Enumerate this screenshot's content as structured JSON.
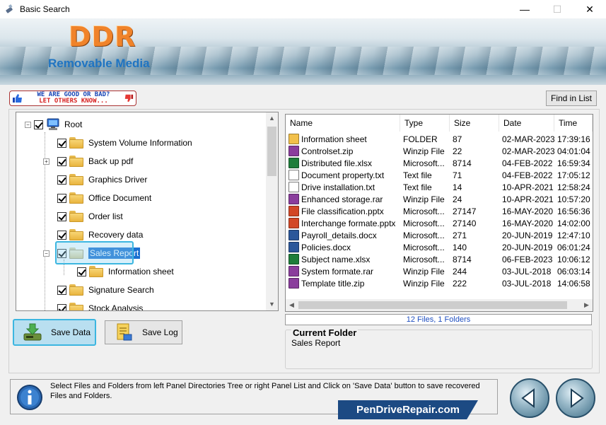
{
  "window": {
    "title": "Basic Search",
    "minimize": "—",
    "maximize": "☐",
    "close": "✕"
  },
  "banner": {
    "brand": "DDR",
    "subtitle": "Removable Media"
  },
  "rating": {
    "line1": "WE ARE GOOD OR BAD?",
    "line2": "LET OTHERS KNOW..."
  },
  "toolbar": {
    "find_label": "Find in List"
  },
  "tree": {
    "root": "Root",
    "items": [
      {
        "label": "System Volume Information",
        "checked": true
      },
      {
        "label": "Back up pdf",
        "checked": true,
        "expandable": true
      },
      {
        "label": "Graphics Driver",
        "checked": true
      },
      {
        "label": "Office Document",
        "checked": true
      },
      {
        "label": "Order list",
        "checked": true
      },
      {
        "label": "Recovery data",
        "checked": true
      },
      {
        "label": "Sales Report",
        "checked": true,
        "expanded": true,
        "selected": true
      },
      {
        "label": "Information sheet",
        "checked": true,
        "child": true
      },
      {
        "label": "Signature Search",
        "checked": true
      },
      {
        "label": "Stock Analysis",
        "checked": true
      }
    ]
  },
  "list": {
    "columns": [
      "Name",
      "Type",
      "Size",
      "Date",
      "Time"
    ],
    "rows": [
      {
        "name": "Information sheet",
        "type": "FOLDER",
        "size": "87",
        "date": "02-MAR-2023",
        "time": "17:39:16",
        "icon": "folder-icon"
      },
      {
        "name": "Controlset.zip",
        "type": "Winzip File",
        "size": "22",
        "date": "02-MAR-2023",
        "time": "04:01:04",
        "icon": "winzip-icon"
      },
      {
        "name": "Distributed file.xlsx",
        "type": "Microsoft...",
        "size": "8714",
        "date": "04-FEB-2022",
        "time": "16:59:34",
        "icon": "excel-icon"
      },
      {
        "name": "Document property.txt",
        "type": "Text file",
        "size": "71",
        "date": "04-FEB-2022",
        "time": "17:05:12",
        "icon": "text-file-icon"
      },
      {
        "name": "Drive installation.txt",
        "type": "Text file",
        "size": "14",
        "date": "10-APR-2021",
        "time": "12:58:24",
        "icon": "text-file-icon"
      },
      {
        "name": "Enhanced storage.rar",
        "type": "Winzip File",
        "size": "24",
        "date": "10-APR-2021",
        "time": "10:57:20",
        "icon": "winzip-icon"
      },
      {
        "name": "File classification.pptx",
        "type": "Microsoft...",
        "size": "27147",
        "date": "16-MAY-2020",
        "time": "16:56:36",
        "icon": "powerpoint-icon"
      },
      {
        "name": "Interchange formate.pptx",
        "type": "Microsoft...",
        "size": "27140",
        "date": "16-MAY-2020",
        "time": "14:02:00",
        "icon": "powerpoint-icon"
      },
      {
        "name": "Payroll_details.docx",
        "type": "Microsoft...",
        "size": "271",
        "date": "20-JUN-2019",
        "time": "12:47:10",
        "icon": "word-icon"
      },
      {
        "name": "Policies.docx",
        "type": "Microsoft...",
        "size": "140",
        "date": "20-JUN-2019",
        "time": "06:01:24",
        "icon": "word-icon"
      },
      {
        "name": "Subject name.xlsx",
        "type": "Microsoft...",
        "size": "8714",
        "date": "06-FEB-2023",
        "time": "10:06:12",
        "icon": "excel-icon"
      },
      {
        "name": "System formate.rar",
        "type": "Winzip File",
        "size": "244",
        "date": "03-JUL-2018",
        "time": "06:03:14",
        "icon": "winzip-icon"
      },
      {
        "name": "Template title.zip",
        "type": "Winzip File",
        "size": "222",
        "date": "03-JUL-2018",
        "time": "14:06:58",
        "icon": "winzip-icon"
      }
    ],
    "status": "12 Files, 1 Folders"
  },
  "current_folder": {
    "heading": "Current Folder",
    "value": "Sales Report"
  },
  "buttons": {
    "save_data": "Save Data",
    "save_log": "Save Log"
  },
  "info": {
    "text": "Select Files and Folders from left Panel Directories Tree or right Panel List and Click on 'Save Data' button to save recovered Files and Folders."
  },
  "footer": {
    "brand": "PenDriveRepair.com"
  },
  "colors": {
    "accent": "#1a6fd0",
    "highlight_border": "#3cb6e0",
    "brand_orange": "#f0832a",
    "subtitle_blue": "#1f74c2",
    "footer_bg": "#1c4a83"
  }
}
